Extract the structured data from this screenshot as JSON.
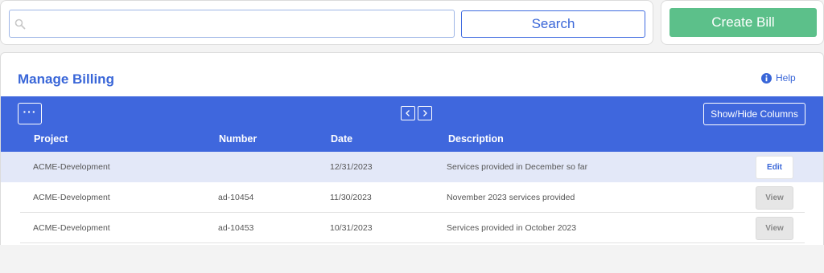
{
  "search": {
    "placeholder": "",
    "value": "",
    "button_label": "Search"
  },
  "create_bill": {
    "label": "Create Bill",
    "color": "#5cc08a"
  },
  "page": {
    "title": "Manage Billing",
    "help_label": "Help",
    "accent_color": "#3f67dd"
  },
  "toolbar": {
    "more_label": "···",
    "prev_icon": "chevron-left-icon",
    "next_icon": "chevron-right-icon",
    "columns_label": "Show/Hide Columns"
  },
  "table": {
    "columns": [
      "Project",
      "Number",
      "Date",
      "Description"
    ],
    "rows": [
      {
        "project": "ACME-Development",
        "number": "",
        "date": "12/31/2023",
        "description": "Services provided in December so far",
        "action": "Edit"
      },
      {
        "project": "ACME-Development",
        "number": "ad-10454",
        "date": "11/30/2023",
        "description": "November 2023 services provided",
        "action": "View"
      },
      {
        "project": "ACME-Development",
        "number": "ad-10453",
        "date": "10/31/2023",
        "description": "Services provided in October 2023",
        "action": "View"
      }
    ]
  }
}
